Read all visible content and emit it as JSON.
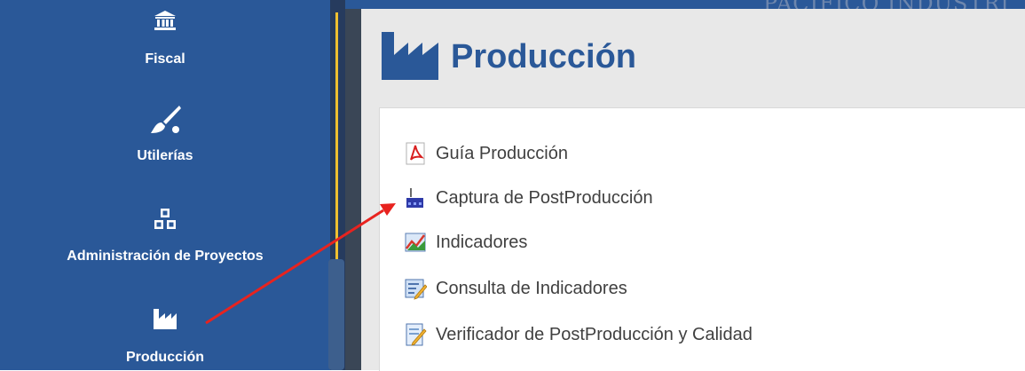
{
  "sidebar": {
    "items": [
      {
        "label": "Fiscal",
        "icon": "bank-icon"
      },
      {
        "label": "Utilerías",
        "icon": "paint-brush-icon"
      },
      {
        "label": "Administración de Proyectos",
        "icon": "cubes-icon"
      },
      {
        "label": "Producción",
        "icon": "industry-icon"
      }
    ]
  },
  "header": {
    "partial_text": "PACIFICO INDUSTRI"
  },
  "page": {
    "title": "Producción",
    "title_icon": "industry-icon",
    "links": [
      {
        "label": "Guía Producción",
        "icon": "pdf-icon"
      },
      {
        "label": "Captura de PostProducción",
        "icon": "factory-icon"
      },
      {
        "label": "Indicadores",
        "icon": "chart-icon"
      },
      {
        "label": "Consulta de Indicadores",
        "icon": "report-edit-icon"
      },
      {
        "label": "Verificador de PostProducción y Calidad",
        "icon": "document-check-icon"
      }
    ]
  },
  "colors": {
    "sidebar": "#2a5898",
    "title": "#2a5898",
    "arrow": "#e8231f",
    "accent": "#f0c030"
  }
}
